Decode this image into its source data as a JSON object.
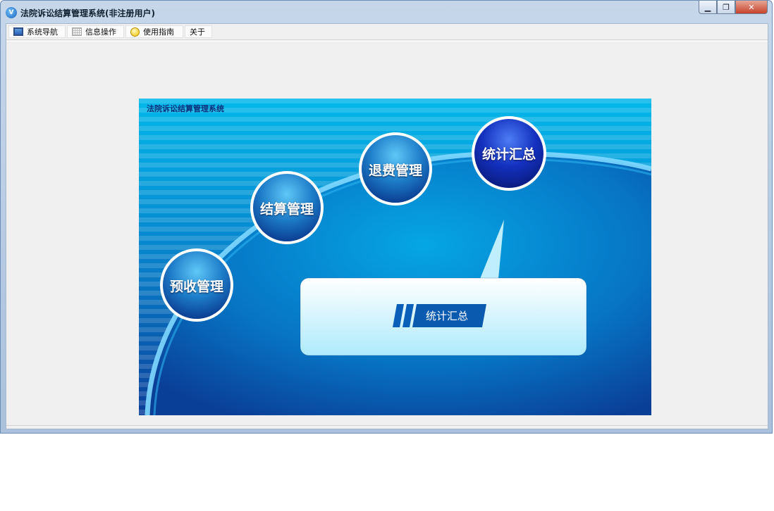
{
  "window": {
    "title": "法院诉讼结算管理系统(非注册用户)",
    "icon": "app-logo-icon",
    "controls": {
      "minimize": "▁",
      "restore": "❐",
      "close": "✕"
    }
  },
  "menu": {
    "items": [
      {
        "label": "系统导航",
        "icon": "monitor-icon"
      },
      {
        "label": "信息操作",
        "icon": "grid-icon"
      },
      {
        "label": "使用指南",
        "icon": "help-icon"
      },
      {
        "label": "关于",
        "icon": ""
      }
    ]
  },
  "banner": {
    "title": "法院诉讼结算管理系统",
    "nodes": [
      {
        "label": "预收管理"
      },
      {
        "label": "结算管理"
      },
      {
        "label": "退费管理"
      },
      {
        "label": "统计汇总",
        "selected": true
      }
    ],
    "detail_label": "统计汇总",
    "colors": {
      "accent": "#00a8e8",
      "deep": "#0b3f9a",
      "panel": "#c8f2ff"
    }
  }
}
